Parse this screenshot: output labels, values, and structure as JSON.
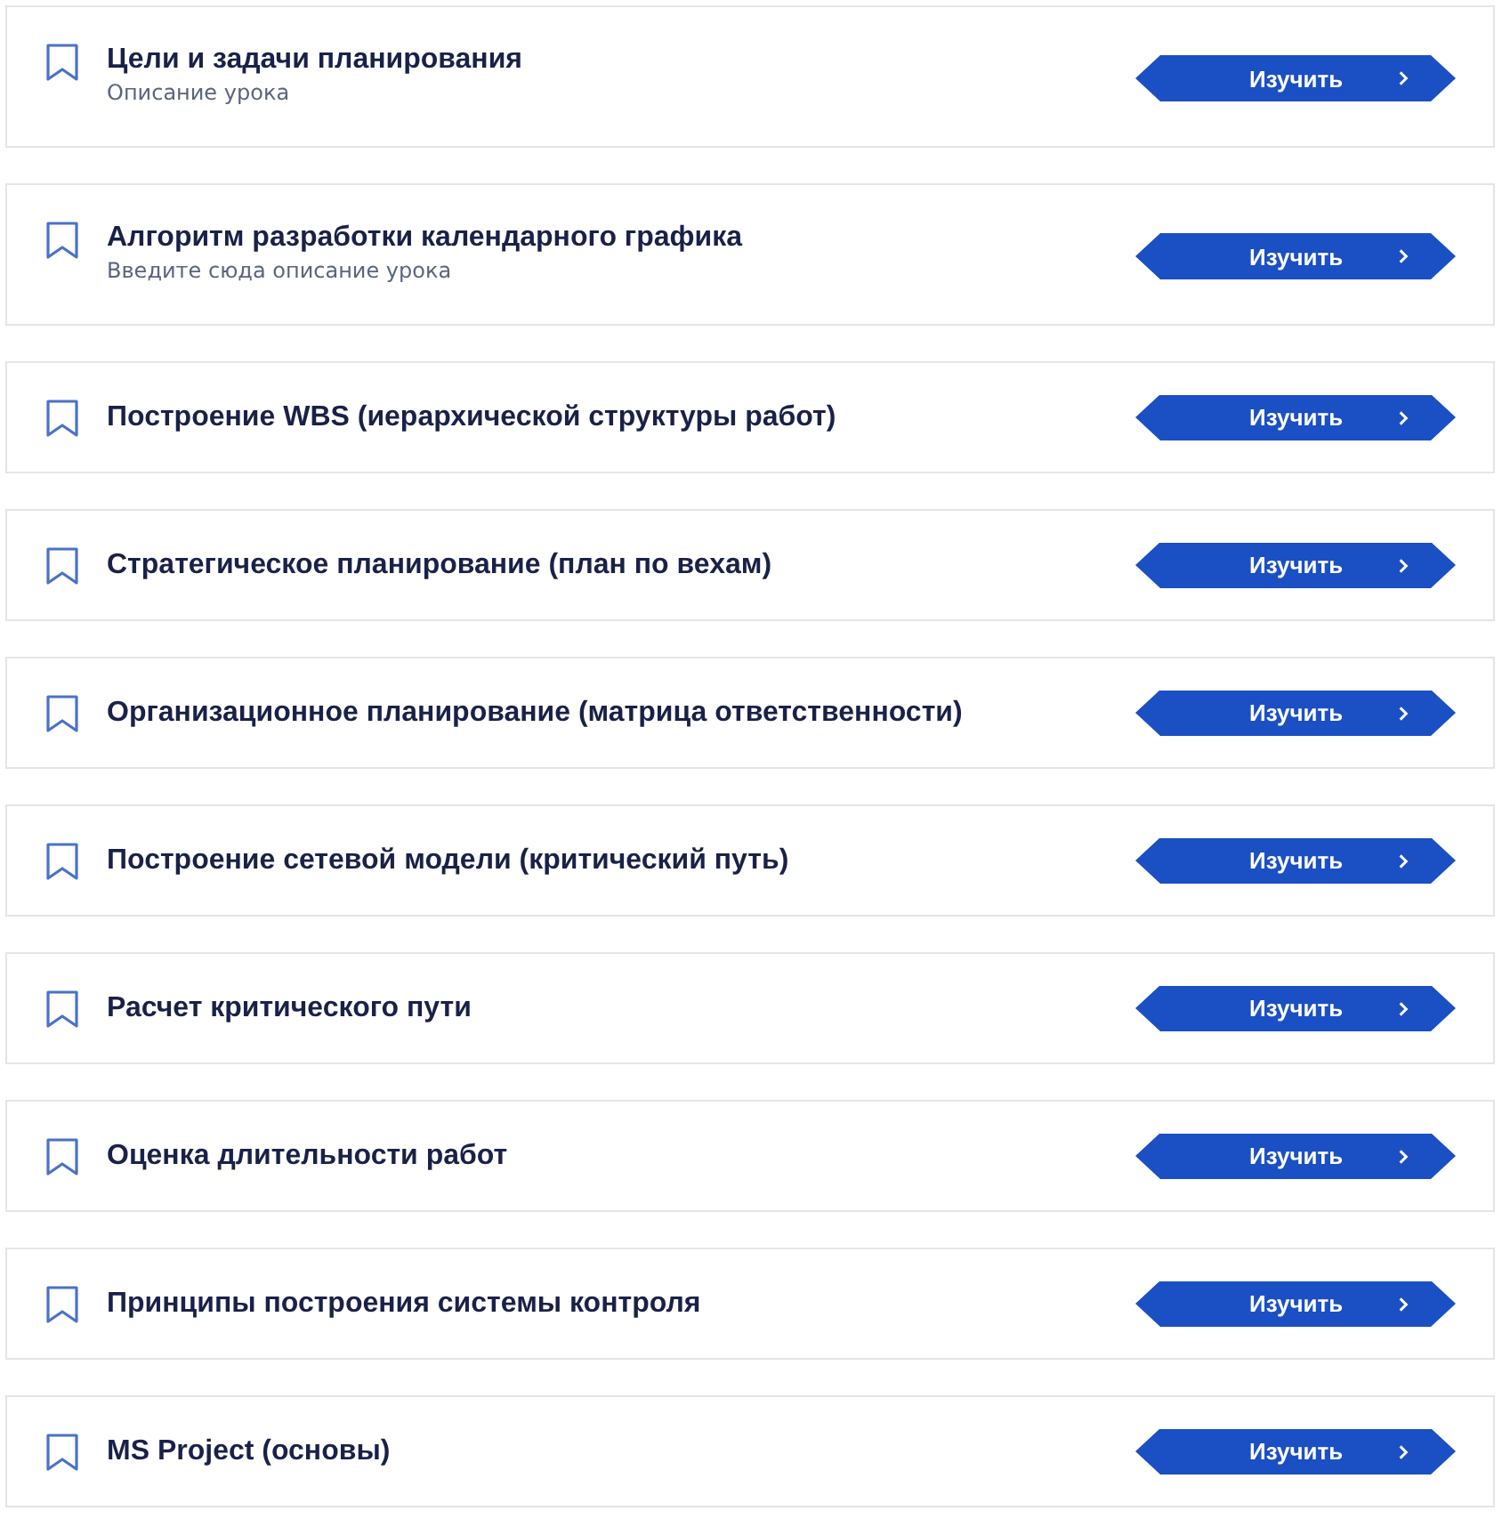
{
  "lessons": [
    {
      "title": "Цели и задачи планирования",
      "description": "Описание урока",
      "button": "Изучить"
    },
    {
      "title": "Алгоритм разработки календарного графика",
      "description": "Введите сюда описание урока",
      "button": "Изучить"
    },
    {
      "title": "Построение WBS (иерархической структуры работ)",
      "button": "Изучить"
    },
    {
      "title": "Стратегическое планирование (план по вехам)",
      "button": "Изучить"
    },
    {
      "title": "Организационное планирование (матрица ответственности)",
      "button": "Изучить"
    },
    {
      "title": "Построение сетевой модели (критический путь)",
      "button": "Изучить"
    },
    {
      "title": "Расчет критического пути",
      "button": "Изучить"
    },
    {
      "title": "Оценка длительности работ",
      "button": "Изучить"
    },
    {
      "title": "Принципы построения системы контроля",
      "button": "Изучить"
    },
    {
      "title": "MS Project (основы)",
      "button": "Изучить"
    }
  ]
}
